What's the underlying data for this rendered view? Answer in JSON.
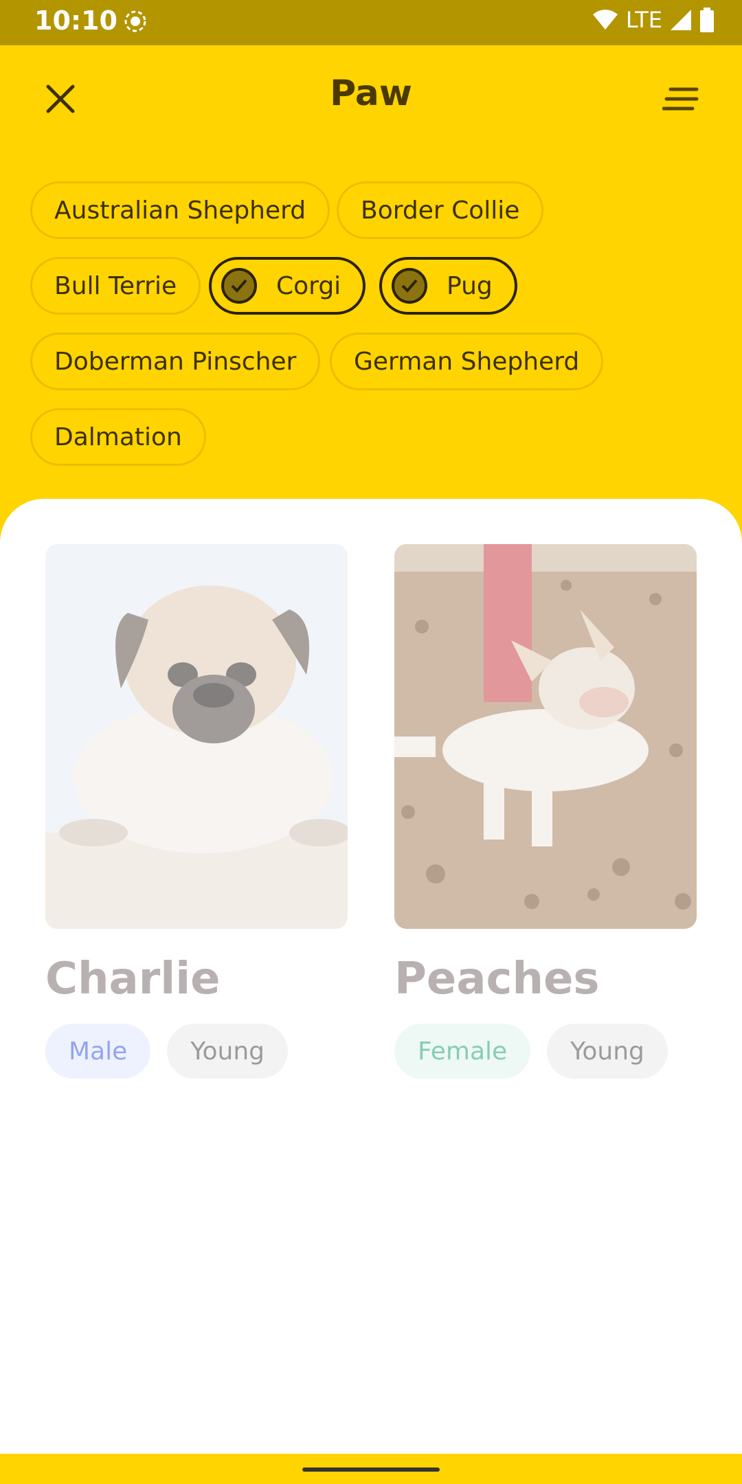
{
  "status_bar": {
    "time": "10:10",
    "network": "LTE",
    "icons": [
      "screen-record-icon",
      "wifi-icon",
      "signal-icon",
      "battery-icon"
    ]
  },
  "app_bar": {
    "title": "Paw",
    "close_icon": "close-icon",
    "menu_icon": "sort-menu-icon"
  },
  "breed_filters": [
    {
      "label": "Australian Shepherd",
      "selected": false
    },
    {
      "label": "Border Collie",
      "selected": false
    },
    {
      "label": "Bull Terrie",
      "selected": false
    },
    {
      "label": "Corgi",
      "selected": true
    },
    {
      "label": "Pug",
      "selected": true
    },
    {
      "label": "Doberman Pinscher",
      "selected": false
    },
    {
      "label": "German Shepherd",
      "selected": false
    },
    {
      "label": "Dalmation",
      "selected": false
    }
  ],
  "pets": [
    {
      "name": "Charlie",
      "gender": "Male",
      "age": "Young",
      "photo": "pug-photo"
    },
    {
      "name": "Peaches",
      "gender": "Female",
      "age": "Young",
      "photo": "corgi-photo"
    }
  ],
  "colors": {
    "brand_yellow": "#FFD400",
    "status_bar": "#B39500",
    "male_tag_text": "#93A4F2",
    "female_tag_text": "#87CDB5"
  }
}
